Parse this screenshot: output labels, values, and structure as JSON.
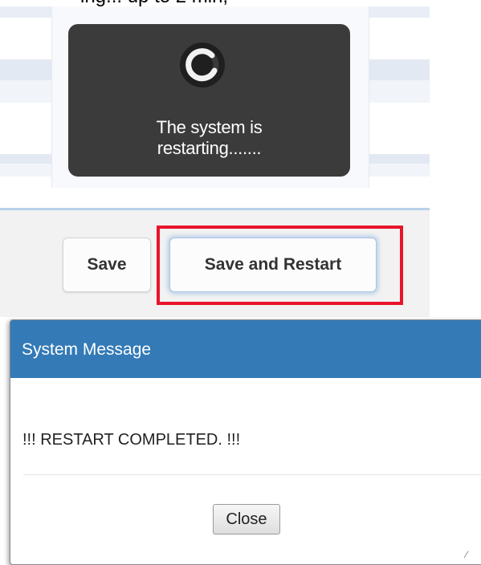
{
  "top_caption": "ing... up to 2 min,",
  "loading": {
    "line1": "The system is",
    "line2": "restarting......."
  },
  "buttons": {
    "save_label": "Save",
    "save_restart_label": "Save and Restart"
  },
  "dialog": {
    "title": "System Message",
    "message": "!!! RESTART COMPLETED. !!!",
    "close_label": "Close"
  },
  "colors": {
    "dialog_header": "#337ab7",
    "overlay": "#3b3b3b",
    "highlight": "#e8142b"
  },
  "icons": {
    "spinner": "spinner-icon"
  }
}
